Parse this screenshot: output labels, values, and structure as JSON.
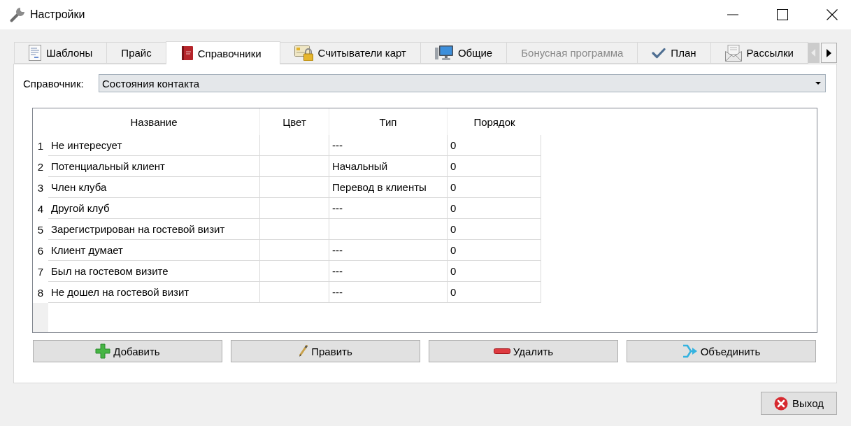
{
  "window": {
    "title": "Настройки"
  },
  "tabs": [
    {
      "label": "Шаблоны",
      "selected": false,
      "disabled": false
    },
    {
      "label": "Прайс",
      "selected": false,
      "disabled": false
    },
    {
      "label": "Справочники",
      "selected": true,
      "disabled": false
    },
    {
      "label": "Считыватели карт",
      "selected": false,
      "disabled": false
    },
    {
      "label": "Общие",
      "selected": false,
      "disabled": false
    },
    {
      "label": "Бонусная программа",
      "selected": false,
      "disabled": true
    },
    {
      "label": "План",
      "selected": false,
      "disabled": false
    },
    {
      "label": "Рассылки",
      "selected": false,
      "disabled": false
    }
  ],
  "tab_scroll": {
    "back_disabled": true,
    "forward_disabled": false
  },
  "reference_picker": {
    "label": "Справочник:",
    "value": "Состояния контакта"
  },
  "table": {
    "columns": [
      "Название",
      "Цвет",
      "Тип",
      "Порядок"
    ],
    "rows": [
      {
        "number": "1",
        "name": "Не интересует",
        "type": "---",
        "order": "0"
      },
      {
        "number": "2",
        "name": "Потенциальный клиент",
        "type": "Начальный",
        "order": "0"
      },
      {
        "number": "3",
        "name": "Член клуба",
        "type": "Перевод в клиенты",
        "order": "0"
      },
      {
        "number": "4",
        "name": "Другой клуб",
        "type": "---",
        "order": "0"
      },
      {
        "number": "5",
        "name": "Зарегистрирован на гостевой визит",
        "order": "0"
      },
      {
        "number": "6",
        "name": "Клиент думает",
        "type": "---",
        "order": "0"
      },
      {
        "number": "7",
        "name": "Был на гостевом визите",
        "type": "---",
        "order": "0"
      },
      {
        "number": "8",
        "name": "Не дошел на гостевой визит",
        "type": "---",
        "order": "0"
      }
    ]
  },
  "actions": [
    "Добавить",
    "Править",
    "Удалить",
    "Объединить"
  ],
  "exit_button": {
    "label": "Выход"
  }
}
